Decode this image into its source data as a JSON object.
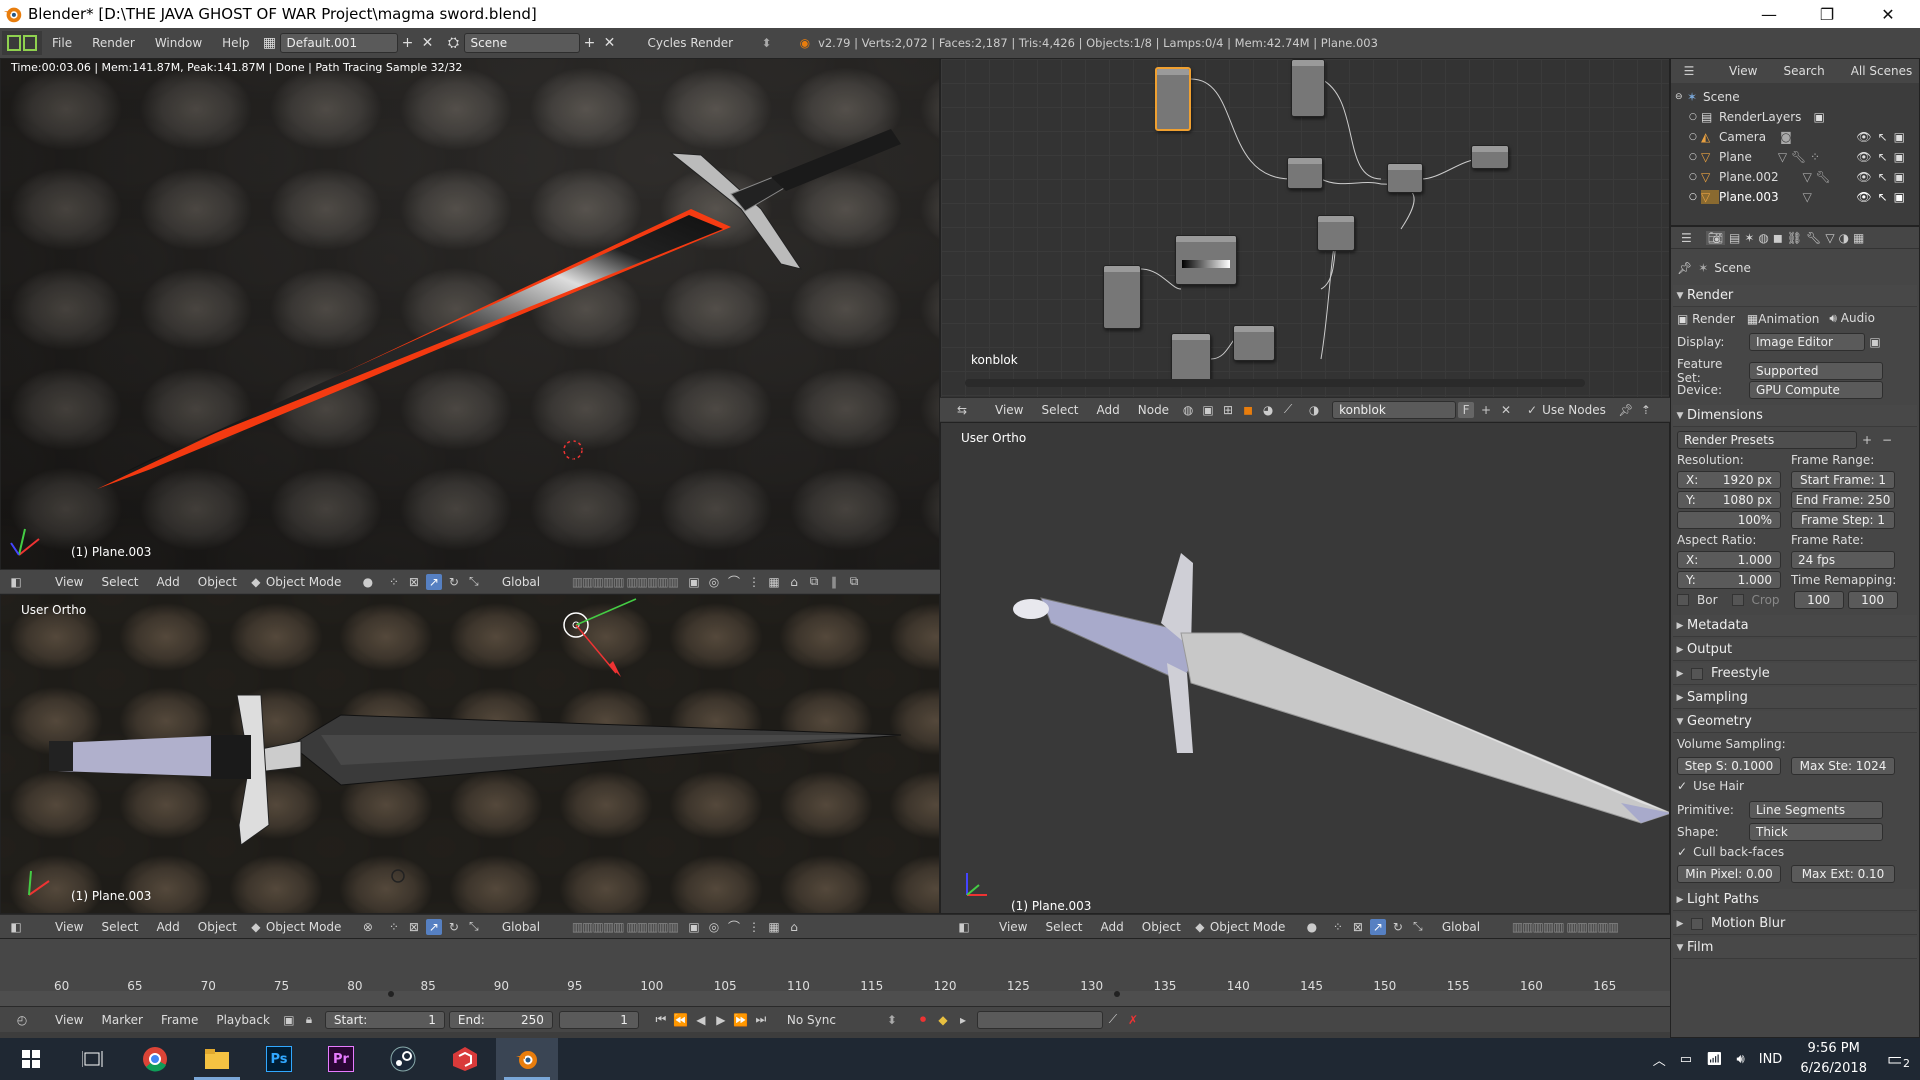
{
  "window": {
    "title": "Blender* [D:\\THE JAVA GHOST OF WAR Project\\magma sword.blend]",
    "minimize": "—",
    "restore": "❐",
    "close": "✕"
  },
  "info_header": {
    "menus": [
      "File",
      "Render",
      "Window",
      "Help"
    ],
    "layout": "Default.001",
    "scene": "Scene",
    "engine": "Cycles Render",
    "stats": "v2.79 | Verts:2,072 | Faces:2,187 | Tris:4,426 | Objects:1/8 | Lamps:0/4 | Mem:42.74M | Plane.003"
  },
  "render_view": {
    "status": "Time:00:03.06 | Mem:141.87M, Peak:141.87M | Done | Path Tracing Sample 32/32",
    "object_label": "(1) Plane.003"
  },
  "viewport_bottom_left": {
    "view_label": "User Ortho",
    "object_label": "(1) Plane.003"
  },
  "viewport_right": {
    "view_label": "User Ortho",
    "object_label": "(1) Plane.003"
  },
  "viewport_header": {
    "menus": [
      "View",
      "Select",
      "Add",
      "Object"
    ],
    "mode": "Object Mode",
    "orientation": "Global"
  },
  "node_editor": {
    "material_label": "konblok",
    "menus": [
      "View",
      "Select",
      "Add",
      "Node"
    ],
    "material_field": "konblok",
    "fake_user": "F",
    "use_nodes": "Use Nodes"
  },
  "outliner": {
    "menus": [
      "View",
      "Search",
      "All Scenes"
    ],
    "items": [
      {
        "label": "Scene",
        "indent": 0
      },
      {
        "label": "RenderLayers",
        "indent": 1
      },
      {
        "label": "Camera",
        "indent": 1
      },
      {
        "label": "Plane",
        "indent": 1
      },
      {
        "label": "Plane.002",
        "indent": 1
      },
      {
        "label": "Plane.003",
        "indent": 1
      }
    ]
  },
  "properties": {
    "context": "Scene",
    "render_panel": "Render",
    "render_btn": "Render",
    "animation_btn": "Animation",
    "audio_btn": "Audio",
    "display_label": "Display:",
    "display_value": "Image Editor",
    "feature_label": "Feature Set:",
    "feature_value": "Supported",
    "device_label": "Device:",
    "device_value": "GPU Compute",
    "dimensions_panel": "Dimensions",
    "render_presets": "Render Presets",
    "resolution_label": "Resolution:",
    "res_x": "X:",
    "res_x_val": "1920 px",
    "res_y": "Y:",
    "res_y_val": "1080 px",
    "res_pct": "100%",
    "frame_range_label": "Frame Range:",
    "start_frame": "Start Frame: 1",
    "end_frame": "End Frame: 250",
    "frame_step": "Frame Step: 1",
    "aspect_label": "Aspect Ratio:",
    "aspect_x": "X:",
    "aspect_x_val": "1.000",
    "aspect_y": "Y:",
    "aspect_y_val": "1.000",
    "frame_rate_label": "Frame Rate:",
    "frame_rate_val": "24 fps",
    "time_remap_label": "Time Remapping:",
    "remap_old": "100",
    "remap_new": "100",
    "border": "Bor",
    "crop": "Crop",
    "metadata_panel": "Metadata",
    "output_panel": "Output",
    "freestyle_panel": "Freestyle",
    "sampling_panel": "Sampling",
    "geometry_panel": "Geometry",
    "volume_sampling": "Volume Sampling:",
    "step_size": "Step S: 0.1000",
    "max_steps": "Max Ste: 1024",
    "use_hair": "Use Hair",
    "primitive_label": "Primitive:",
    "primitive_val": "Line Segments",
    "shape_label": "Shape:",
    "shape_val": "Thick",
    "cull": "Cull back-faces",
    "min_pixel": "Min Pixel: 0.00",
    "max_ext": "Max Ext: 0.10",
    "light_paths_panel": "Light Paths",
    "motion_blur_panel": "Motion Blur",
    "film_panel": "Film"
  },
  "timeline": {
    "ticks": [
      "60",
      "65",
      "70",
      "75",
      "80",
      "85",
      "90",
      "95",
      "100",
      "105",
      "110",
      "115",
      "120",
      "125",
      "130",
      "135",
      "140",
      "145",
      "150",
      "155",
      "160",
      "165"
    ],
    "menus": [
      "View",
      "Marker",
      "Frame",
      "Playback"
    ],
    "start_label": "Start:",
    "start_val": "1",
    "end_label": "End:",
    "end_val": "250",
    "current": "1",
    "sync": "No Sync"
  },
  "taskbar": {
    "language": "IND",
    "time": "9:56 PM",
    "date": "6/26/2018",
    "notif_count": "2"
  },
  "colors": {
    "accent_blue": "#5680c2",
    "selected_node": "#f0a030",
    "magma": "#ff4a1a"
  }
}
